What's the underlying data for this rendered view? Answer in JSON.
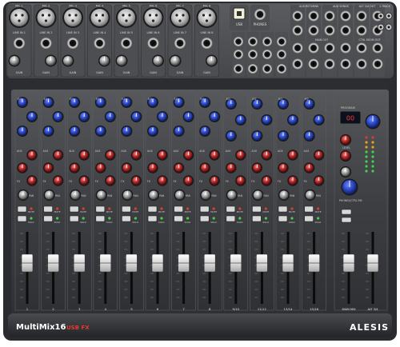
{
  "device": {
    "model": "MultiMix16",
    "model_suffix": "USB FX",
    "brand": "ALESIS",
    "main_mix_label": "MAIN MIX",
    "alt_label": "ALT 3/4"
  },
  "input_jacks": {
    "xlr_label": "MIC",
    "line_label": "LINE IN",
    "gain_label": "GAIN",
    "mic_channels": 8,
    "usb_label": "USB",
    "phones_label": "PHONES"
  },
  "rear_labels": {
    "aux_returns": "AUX RETURNS",
    "aux_sends": "AUX SENDS",
    "alt_out": "ALT 3/4 OUT",
    "tape": "2-TRACK",
    "main_out": "MAIN OUT",
    "ctrl_room": "CTRL ROOM OUT"
  },
  "channel_strip": {
    "eq_label": "EQ",
    "aux_label": "AUX",
    "pan_label": "PAN",
    "mute_label": "MUTE",
    "fx_label": "FX",
    "peak_label": "PK",
    "mute_alt_label": "MUTE ALT 3/4",
    "solo_label": "SOLO"
  },
  "fader_labels": [
    "1",
    "2",
    "3",
    "4",
    "5",
    "6",
    "7",
    "8",
    "9/10",
    "11/12",
    "13/14",
    "15/16"
  ],
  "master": {
    "fx_program_label": "PROGRAM",
    "display_value": "00",
    "level_label": "LEVEL",
    "phones_level_label": "PHONES/CTRL RM"
  },
  "colors": {
    "panel": "#3b3c40",
    "knob_blue": "#2a47c4",
    "knob_red": "#b02525",
    "knob_grey": "#9a9a9a",
    "fader_cap": "#e8e8e8",
    "led_green": "#3fd34a",
    "led_amber": "#e8a21c",
    "led_red": "#e23a2a"
  }
}
